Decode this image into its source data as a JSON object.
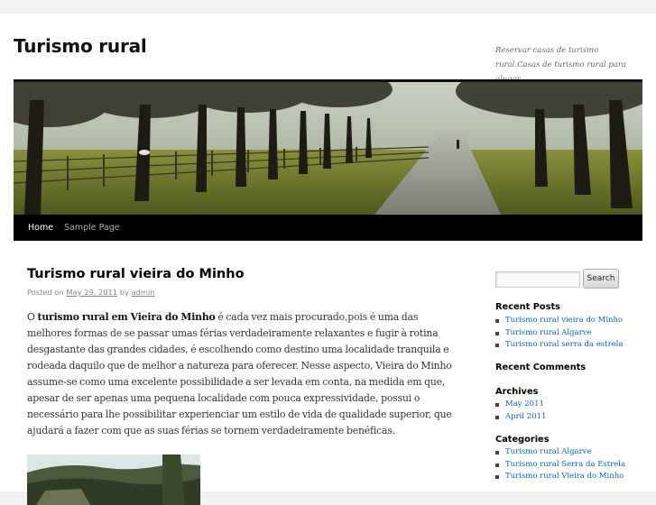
{
  "site": {
    "title": "Turismo rural",
    "description": "Reservar casas de turismo rural.Casas de turismo rural para alugar."
  },
  "nav": {
    "items": [
      {
        "label": "Home"
      },
      {
        "label": "Sample Page"
      }
    ]
  },
  "post": {
    "title": "Turismo rural vieira do Minho",
    "meta": {
      "posted_on": "Posted on",
      "date": "May 29, 2011",
      "by": "by",
      "author": "admin"
    },
    "body": {
      "intro": "O",
      "keyword": "turismo rural em Vieira do Minho",
      "rest": "é cada vez mais procurado,pois é uma das melhores formas de se passar umas férias verdadeiramente relaxantes e fugir à rotina desgastante das grandes cidades, é escolhendo como destino uma localidade tranquila e rodeada daquilo que de melhor a natureza para oferecer. Nesse aspecto, Vieira do Minho assume-se como uma excelente possibilidade a ser levada em conta, na medida em que, apesar de ser apenas uma pequena localidade com pouca expressividade, possui o necessário para lhe possibilitar experienciar um estilo de vida de qualidade superior, que ajudará a fazer com que as suas férias se tornem verdadeiramente benéficas."
    }
  },
  "sidebar": {
    "search": {
      "placeholder": "",
      "button_label": "Search"
    },
    "recent_posts": {
      "title": "Recent Posts",
      "items": [
        {
          "label": "Turismo rural vieira do Minho"
        },
        {
          "label": "Turismo rural Algarve"
        },
        {
          "label": "Turismo rural serra da estrela"
        }
      ]
    },
    "recent_comments": {
      "title": "Recent Comments"
    },
    "archives": {
      "title": "Archives",
      "items": [
        {
          "label": "May 2011"
        },
        {
          "label": "April 2011"
        }
      ]
    },
    "categories": {
      "title": "Categories",
      "items": [
        {
          "label": "Turismo rural Algarve"
        },
        {
          "label": "Turismo rural Serra da Estrela"
        },
        {
          "label": "Turismo rural Vieira do Minho"
        }
      ]
    }
  },
  "colors": {
    "link": "#0066cc",
    "nav_background": "#000000",
    "page_background": "#f1f1f1"
  }
}
